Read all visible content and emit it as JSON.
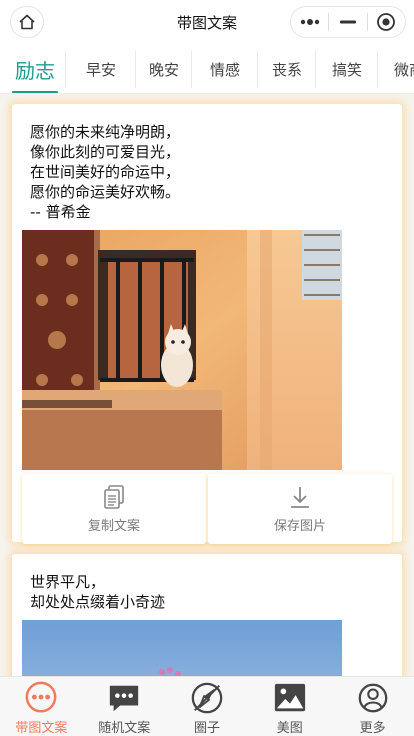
{
  "navbar": {
    "title": "带图文案",
    "home_icon": "home-icon",
    "menu_icon": "more-dots-icon",
    "minimize_icon": "minimize-icon",
    "close_icon": "target-close-icon"
  },
  "tabs": [
    {
      "label": "励志",
      "active": true
    },
    {
      "label": "早安",
      "active": false
    },
    {
      "label": "晚安",
      "active": false
    },
    {
      "label": "情感",
      "active": false
    },
    {
      "label": "丧系",
      "active": false
    },
    {
      "label": "搞笑",
      "active": false
    },
    {
      "label": "微商",
      "active": false
    }
  ],
  "accent_color": "#1c9c8f",
  "posts": [
    {
      "lines": [
        "愿你的未来纯净明朗，",
        "像你此刻的可爱目光，",
        "在世间美好的命运中，",
        "愿你的命运美好欢畅。",
        "-- 普希金"
      ],
      "image": "kitten-on-balcony-photo",
      "copy_label": "复制文案",
      "save_label": "保存图片"
    },
    {
      "lines": [
        "世界平凡，",
        "却处处点缀着小奇迹"
      ],
      "image": "blue-sky-photo"
    }
  ],
  "bottom_nav": [
    {
      "label": "带图文案",
      "icon": "chat-bubble-icon",
      "active": true
    },
    {
      "label": "随机文案",
      "icon": "message-icon",
      "active": false
    },
    {
      "label": "圈子",
      "icon": "compass-icon",
      "active": false
    },
    {
      "label": "美图",
      "icon": "picture-icon",
      "active": false
    },
    {
      "label": "更多",
      "icon": "user-icon",
      "active": false
    }
  ],
  "active_bottom_color": "#f07b5b"
}
